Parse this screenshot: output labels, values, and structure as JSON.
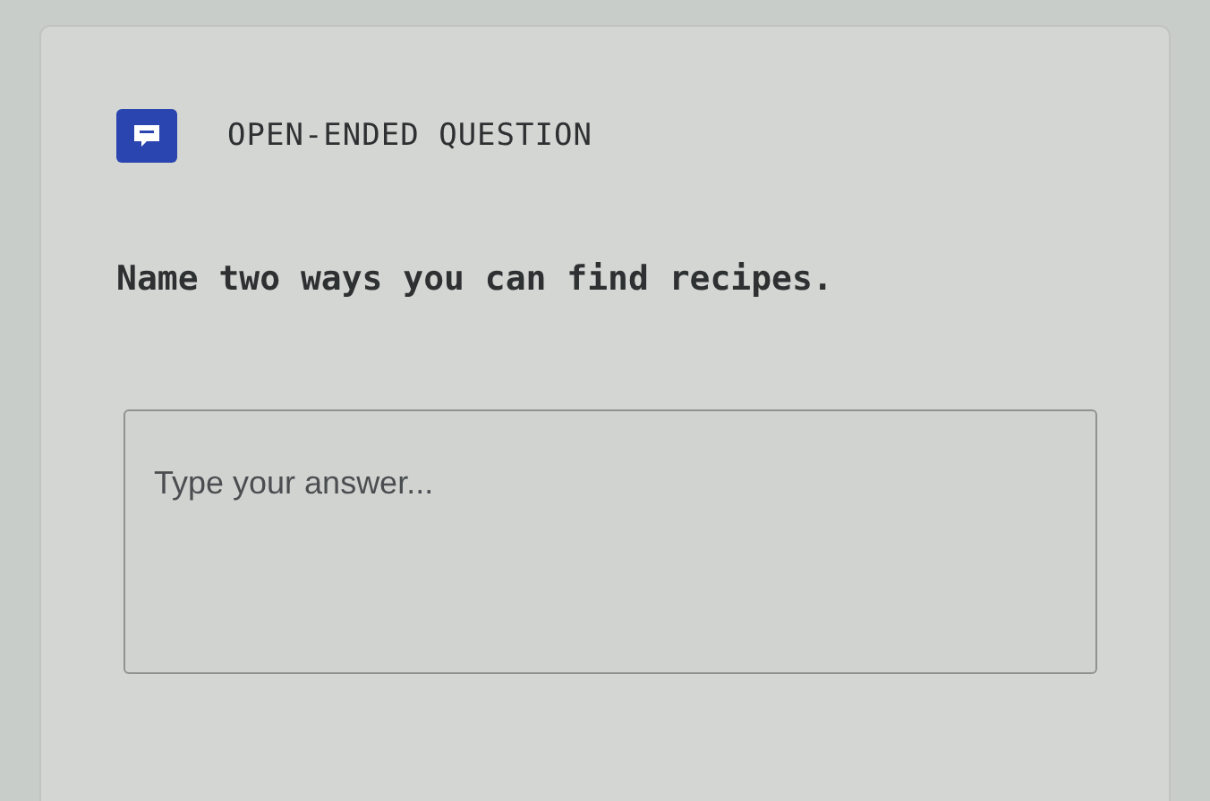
{
  "question_type": "OPEN-ENDED QUESTION",
  "question": "Name two ways you can find recipes.",
  "answer": {
    "placeholder": "Type your answer..."
  }
}
